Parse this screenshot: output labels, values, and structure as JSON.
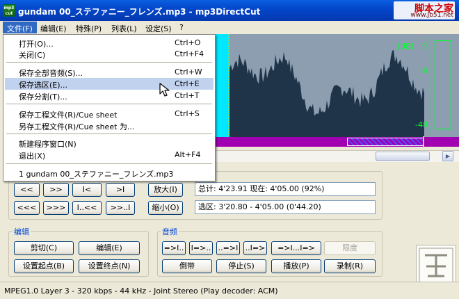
{
  "window": {
    "title": "gundam 00_ステファニー_フレンズ.mp3 - mp3DirectCut",
    "app_icon_text": "mp3 cut"
  },
  "watermark": {
    "main": "脚本之家",
    "sub": "www.Jb51.net"
  },
  "menubar": [
    {
      "label": "文件(F)"
    },
    {
      "label": "编辑(E)"
    },
    {
      "label": "特殊(P)"
    },
    {
      "label": "列表(L)"
    },
    {
      "label": "设定(S)"
    },
    {
      "label": "?"
    }
  ],
  "file_menu": {
    "items": [
      {
        "label": "打开(O)...",
        "shortcut": "Ctrl+O"
      },
      {
        "label": "关闭(C)",
        "shortcut": "Ctrl+F4"
      },
      {
        "label": "保存全部音频(S)...",
        "shortcut": "Ctrl+W"
      },
      {
        "label": "保存选区(E)...",
        "shortcut": "Ctrl+E"
      },
      {
        "label": "保存分割(T)...",
        "shortcut": "Ctrl+T"
      },
      {
        "label": "保存工程文件(R)/Cue sheet",
        "shortcut": "Ctrl+S"
      },
      {
        "label": "另存工程文件(R)/Cue sheet 为...",
        "shortcut": ""
      },
      {
        "label": "新建程序窗口(N)",
        "shortcut": ""
      },
      {
        "label": "退出(X)",
        "shortcut": "Alt+F4"
      },
      {
        "label": "1 gundam 00_ステファニー_フレンズ.mp3",
        "shortcut": ""
      }
    ],
    "highlighted_index": 3
  },
  "waveform": {
    "db_labels": [
      "[dB]",
      "0",
      "-6",
      "-48"
    ],
    "colors": {
      "background": "#8c9eb0",
      "wave": "#1f3448",
      "cursor_strip": "#00e7ff",
      "meter": "#00ff2a",
      "timeline": "#a000b0"
    },
    "scroll_arrow": "▶"
  },
  "navigation": {
    "row1": [
      "<<",
      ">>",
      "I<",
      ">I"
    ],
    "row2": [
      "<<<",
      ">>>",
      "I..<<",
      ">>..I"
    ],
    "zoom_in": "放大(I)",
    "zoom_out": "缩小(O)",
    "total_info": "总计: 4'23.91  现在: 4'05.00  (92%)",
    "selection_info": "选区: 3'20.80 - 4'05.00 (0'44.20)"
  },
  "edit_group": {
    "title": "编辑",
    "buttons": [
      "剪切(C)",
      "编辑(E)",
      "设置起点(B)",
      "设置终点(N)"
    ]
  },
  "audio_group": {
    "title": "音频",
    "fade_buttons": [
      "=>I..",
      "I=>..",
      "..=>I",
      "..I=>",
      "=>I...I=>"
    ],
    "limit_label": "限度",
    "transport": [
      "倒带",
      "停止(S)",
      "播放(P)",
      "录制(R)"
    ]
  },
  "status": {
    "text": "MPEG1.0 Layer 3 - 320 kbps - 44 kHz - Joint Stereo   (Play decoder: ACM)"
  }
}
